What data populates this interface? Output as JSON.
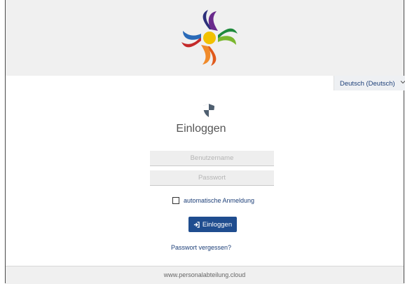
{
  "header": {
    "logo_icon": "colorful-swirl-logo-icon"
  },
  "language": {
    "selected": "Deutsch (Deutsch)",
    "icon": "chevron-down-icon"
  },
  "login": {
    "icon": "shield-icon",
    "title": "Einloggen",
    "username_placeholder": "Benutzername",
    "password_placeholder": "Passwort",
    "remember_label": "automatische Anmeldung",
    "remember_checked": false,
    "submit_label": "Einloggen",
    "submit_icon": "sign-in-icon",
    "forgot_link": "Passwort vergessen?"
  },
  "footer": {
    "text": "www.personalabteilung.cloud"
  },
  "colors": {
    "primary": "#1f4d8f",
    "link": "#1d3f78",
    "header_bg": "#f0f0f0"
  }
}
